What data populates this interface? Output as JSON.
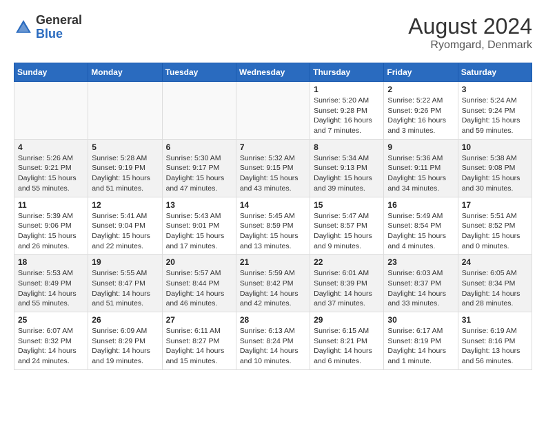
{
  "header": {
    "logo_line1": "General",
    "logo_line2": "Blue",
    "month_year": "August 2024",
    "location": "Ryomgard, Denmark"
  },
  "weekdays": [
    "Sunday",
    "Monday",
    "Tuesday",
    "Wednesday",
    "Thursday",
    "Friday",
    "Saturday"
  ],
  "weeks": [
    [
      {
        "day": "",
        "info": ""
      },
      {
        "day": "",
        "info": ""
      },
      {
        "day": "",
        "info": ""
      },
      {
        "day": "",
        "info": ""
      },
      {
        "day": "1",
        "info": "Sunrise: 5:20 AM\nSunset: 9:28 PM\nDaylight: 16 hours\nand 7 minutes."
      },
      {
        "day": "2",
        "info": "Sunrise: 5:22 AM\nSunset: 9:26 PM\nDaylight: 16 hours\nand 3 minutes."
      },
      {
        "day": "3",
        "info": "Sunrise: 5:24 AM\nSunset: 9:24 PM\nDaylight: 15 hours\nand 59 minutes."
      }
    ],
    [
      {
        "day": "4",
        "info": "Sunrise: 5:26 AM\nSunset: 9:21 PM\nDaylight: 15 hours\nand 55 minutes."
      },
      {
        "day": "5",
        "info": "Sunrise: 5:28 AM\nSunset: 9:19 PM\nDaylight: 15 hours\nand 51 minutes."
      },
      {
        "day": "6",
        "info": "Sunrise: 5:30 AM\nSunset: 9:17 PM\nDaylight: 15 hours\nand 47 minutes."
      },
      {
        "day": "7",
        "info": "Sunrise: 5:32 AM\nSunset: 9:15 PM\nDaylight: 15 hours\nand 43 minutes."
      },
      {
        "day": "8",
        "info": "Sunrise: 5:34 AM\nSunset: 9:13 PM\nDaylight: 15 hours\nand 39 minutes."
      },
      {
        "day": "9",
        "info": "Sunrise: 5:36 AM\nSunset: 9:11 PM\nDaylight: 15 hours\nand 34 minutes."
      },
      {
        "day": "10",
        "info": "Sunrise: 5:38 AM\nSunset: 9:08 PM\nDaylight: 15 hours\nand 30 minutes."
      }
    ],
    [
      {
        "day": "11",
        "info": "Sunrise: 5:39 AM\nSunset: 9:06 PM\nDaylight: 15 hours\nand 26 minutes."
      },
      {
        "day": "12",
        "info": "Sunrise: 5:41 AM\nSunset: 9:04 PM\nDaylight: 15 hours\nand 22 minutes."
      },
      {
        "day": "13",
        "info": "Sunrise: 5:43 AM\nSunset: 9:01 PM\nDaylight: 15 hours\nand 17 minutes."
      },
      {
        "day": "14",
        "info": "Sunrise: 5:45 AM\nSunset: 8:59 PM\nDaylight: 15 hours\nand 13 minutes."
      },
      {
        "day": "15",
        "info": "Sunrise: 5:47 AM\nSunset: 8:57 PM\nDaylight: 15 hours\nand 9 minutes."
      },
      {
        "day": "16",
        "info": "Sunrise: 5:49 AM\nSunset: 8:54 PM\nDaylight: 15 hours\nand 4 minutes."
      },
      {
        "day": "17",
        "info": "Sunrise: 5:51 AM\nSunset: 8:52 PM\nDaylight: 15 hours\nand 0 minutes."
      }
    ],
    [
      {
        "day": "18",
        "info": "Sunrise: 5:53 AM\nSunset: 8:49 PM\nDaylight: 14 hours\nand 55 minutes."
      },
      {
        "day": "19",
        "info": "Sunrise: 5:55 AM\nSunset: 8:47 PM\nDaylight: 14 hours\nand 51 minutes."
      },
      {
        "day": "20",
        "info": "Sunrise: 5:57 AM\nSunset: 8:44 PM\nDaylight: 14 hours\nand 46 minutes."
      },
      {
        "day": "21",
        "info": "Sunrise: 5:59 AM\nSunset: 8:42 PM\nDaylight: 14 hours\nand 42 minutes."
      },
      {
        "day": "22",
        "info": "Sunrise: 6:01 AM\nSunset: 8:39 PM\nDaylight: 14 hours\nand 37 minutes."
      },
      {
        "day": "23",
        "info": "Sunrise: 6:03 AM\nSunset: 8:37 PM\nDaylight: 14 hours\nand 33 minutes."
      },
      {
        "day": "24",
        "info": "Sunrise: 6:05 AM\nSunset: 8:34 PM\nDaylight: 14 hours\nand 28 minutes."
      }
    ],
    [
      {
        "day": "25",
        "info": "Sunrise: 6:07 AM\nSunset: 8:32 PM\nDaylight: 14 hours\nand 24 minutes."
      },
      {
        "day": "26",
        "info": "Sunrise: 6:09 AM\nSunset: 8:29 PM\nDaylight: 14 hours\nand 19 minutes."
      },
      {
        "day": "27",
        "info": "Sunrise: 6:11 AM\nSunset: 8:27 PM\nDaylight: 14 hours\nand 15 minutes."
      },
      {
        "day": "28",
        "info": "Sunrise: 6:13 AM\nSunset: 8:24 PM\nDaylight: 14 hours\nand 10 minutes."
      },
      {
        "day": "29",
        "info": "Sunrise: 6:15 AM\nSunset: 8:21 PM\nDaylight: 14 hours\nand 6 minutes."
      },
      {
        "day": "30",
        "info": "Sunrise: 6:17 AM\nSunset: 8:19 PM\nDaylight: 14 hours\nand 1 minute."
      },
      {
        "day": "31",
        "info": "Sunrise: 6:19 AM\nSunset: 8:16 PM\nDaylight: 13 hours\nand 56 minutes."
      }
    ]
  ]
}
